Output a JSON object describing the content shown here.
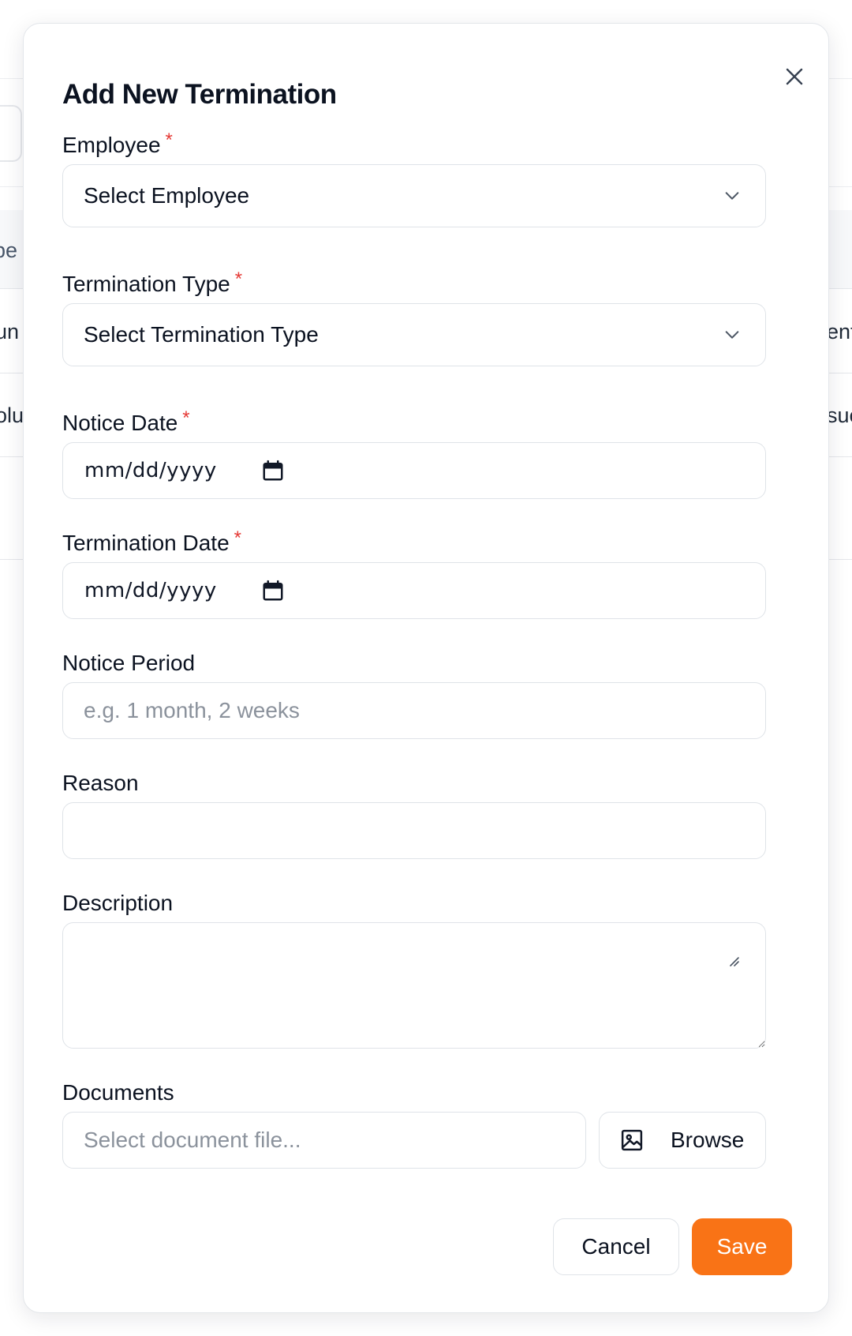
{
  "background": {
    "table_header_fragment": "pe",
    "row1_left_fragment": "un",
    "row1_right_fragment": "ent",
    "row2_left_fragment": "olu",
    "row2_right_fragment": "sue"
  },
  "modal": {
    "title": "Add New Termination",
    "close_icon": "close-icon",
    "required_marker": "*",
    "fields": {
      "employee": {
        "label": "Employee",
        "value": "Select Employee"
      },
      "termination_type": {
        "label": "Termination Type",
        "value": "Select Termination Type"
      },
      "notice_date": {
        "label": "Notice Date",
        "placeholder": "mm/dd/yyyy"
      },
      "termination_date": {
        "label": "Termination Date",
        "placeholder": "mm/dd/yyyy"
      },
      "notice_period": {
        "label": "Notice Period",
        "placeholder": "e.g. 1 month, 2 weeks",
        "value": ""
      },
      "reason": {
        "label": "Reason",
        "value": ""
      },
      "description": {
        "label": "Description",
        "value": ""
      },
      "documents": {
        "label": "Documents",
        "placeholder": "Select document file...",
        "browse_label": "Browse",
        "browse_icon": "image-icon"
      }
    },
    "actions": {
      "cancel_label": "Cancel",
      "save_label": "Save"
    },
    "colors": {
      "accent": "#f97316",
      "required": "#e53935",
      "border": "#dfe3e8"
    }
  }
}
